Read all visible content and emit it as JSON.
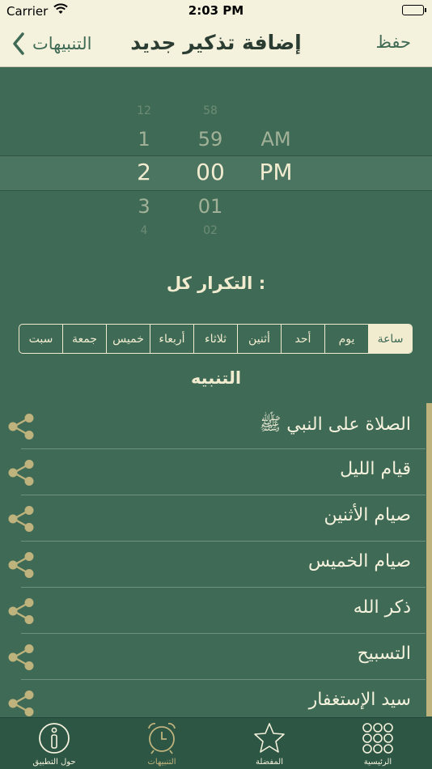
{
  "status_bar": {
    "carrier": "Carrier",
    "time": "2:03 PM"
  },
  "nav": {
    "back_label": "التنبيهات",
    "title": "إضافة تذكير جديد",
    "save_label": "حفظ"
  },
  "picker": {
    "hours": [
      "12",
      "1",
      "2",
      "3",
      "4"
    ],
    "minutes": [
      "58",
      "59",
      "00",
      "01",
      "02"
    ],
    "ampm": [
      "",
      "AM",
      "PM",
      "",
      ""
    ]
  },
  "repeat": {
    "label": "التكرار كل :",
    "options": [
      "ساعة",
      "يوم",
      "أحد",
      "أثنين",
      "ثلاثاء",
      "أربعاء",
      "خميس",
      "جمعة",
      "سبت"
    ],
    "selected": "ساعة"
  },
  "alert_label": "التنبيه",
  "alerts": [
    "الصلاة على النبي ﷺ",
    "قيام الليل",
    "صيام الأثنين",
    "صيام الخميس",
    "ذكر الله",
    "التسبيح",
    "سيد الإستغفار"
  ],
  "tabs": [
    {
      "label": "الرئيسية",
      "icon": "grid-icon"
    },
    {
      "label": "المفضلة",
      "icon": "star-icon"
    },
    {
      "label": "التنبيهات",
      "icon": "alarm-clock-icon"
    },
    {
      "label": "حول التطبيق",
      "icon": "info-icon"
    }
  ],
  "colors": {
    "background": "#3f6a55",
    "bar": "#f4f1dc",
    "accent": "#bfb37d",
    "tabbar": "#2d5644"
  }
}
